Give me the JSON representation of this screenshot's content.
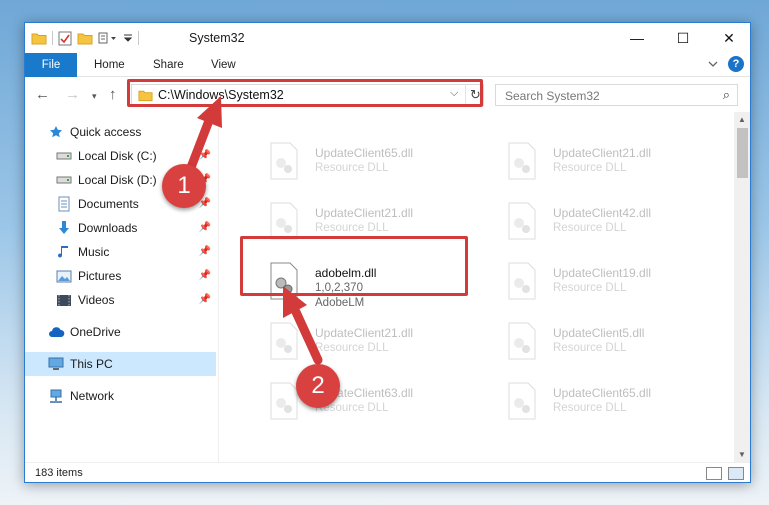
{
  "window": {
    "title": "System32",
    "controls": {
      "minimize": "—",
      "maximize": "☐",
      "close": "✕"
    }
  },
  "ribbon": {
    "tabs": [
      "File",
      "Home",
      "Share",
      "View"
    ]
  },
  "navigation": {
    "address": "C:\\Windows\\System32",
    "search_placeholder": "Search System32"
  },
  "sidebar": {
    "items": [
      {
        "label": "Quick access",
        "icon": "star-icon",
        "pinned": false
      },
      {
        "label": "Local Disk (C:)",
        "icon": "drive-icon",
        "pinned": true
      },
      {
        "label": "Local Disk (D:)",
        "icon": "drive-icon",
        "pinned": true
      },
      {
        "label": "Documents",
        "icon": "documents-icon",
        "pinned": true
      },
      {
        "label": "Downloads",
        "icon": "download-icon",
        "pinned": true
      },
      {
        "label": "Music",
        "icon": "music-icon",
        "pinned": true
      },
      {
        "label": "Pictures",
        "icon": "pictures-icon",
        "pinned": true
      },
      {
        "label": "Videos",
        "icon": "videos-icon",
        "pinned": true
      },
      {
        "label": "OneDrive",
        "icon": "cloud-icon",
        "pinned": false
      },
      {
        "label": "This PC",
        "icon": "computer-icon",
        "pinned": false,
        "selected": true
      },
      {
        "label": "Network",
        "icon": "network-icon",
        "pinned": false
      }
    ]
  },
  "files": [
    {
      "name": "UpdateClient65.dll",
      "type": "Resource DLL",
      "faded": true
    },
    {
      "name": "UpdateClient21.dll",
      "type": "Resource DLL",
      "faded": true
    },
    {
      "name": "UpdateClient21.dll",
      "type": "Resource DLL",
      "faded": true
    },
    {
      "name": "UpdateClient42.dll",
      "type": "Resource DLL",
      "faded": true
    },
    {
      "name": "adobelm.dll",
      "version": "1,0,2,370",
      "type": "AdobeLM",
      "faded": false,
      "highlighted": true
    },
    {
      "name": "UpdateClient19.dll",
      "type": "Resource DLL",
      "faded": true
    },
    {
      "name": "UpdateClient21.dll",
      "type": "Resource DLL",
      "faded": true
    },
    {
      "name": "UpdateClient5.dll",
      "type": "Resource DLL",
      "faded": true
    },
    {
      "name": "UpdateClient63.dll",
      "type": "Resource DLL",
      "faded": true
    },
    {
      "name": "UpdateClient65.dll",
      "type": "Resource DLL",
      "faded": true
    }
  ],
  "status": {
    "item_count": "183 items"
  },
  "annotations": {
    "markers": [
      "1",
      "2"
    ],
    "color": "#d33a3a"
  },
  "colors": {
    "accent": "#1979ca",
    "selection": "#cce8ff"
  }
}
